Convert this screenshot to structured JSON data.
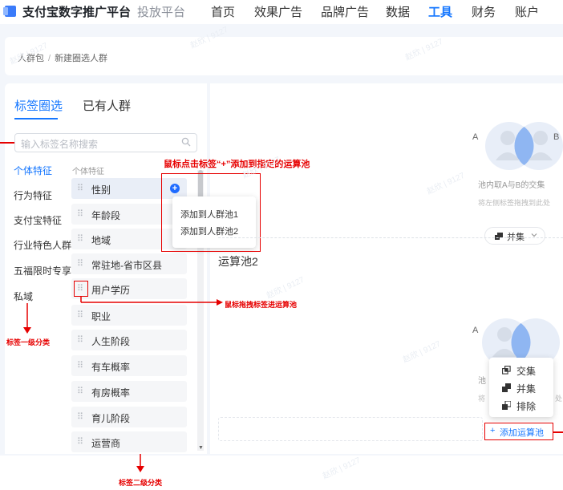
{
  "nav": {
    "brand": "支付宝数字推广平台",
    "sub": "投放平台",
    "items": [
      {
        "label": "首页",
        "active": false
      },
      {
        "label": "效果广告",
        "active": false
      },
      {
        "label": "品牌广告",
        "active": false
      },
      {
        "label": "数据",
        "active": false
      },
      {
        "label": "工具",
        "active": true
      },
      {
        "label": "财务",
        "active": false
      },
      {
        "label": "账户",
        "active": false
      }
    ]
  },
  "breadcrumb": {
    "root": "人群包",
    "separator": "/",
    "current": "新建圈选人群"
  },
  "tabs": [
    {
      "label": "标签圈选",
      "active": true
    },
    {
      "label": "已有人群",
      "active": false
    }
  ],
  "search": {
    "placeholder": "输入标签名称搜索"
  },
  "categories": [
    {
      "label": "个体特征",
      "active": true
    },
    {
      "label": "行为特征",
      "active": false
    },
    {
      "label": "支付宝特征",
      "active": false
    },
    {
      "label": "行业特色人群",
      "active": false
    },
    {
      "label": "五福限时专享",
      "active": false
    },
    {
      "label": "私域",
      "active": false
    }
  ],
  "subcategory_heading": "个体特征",
  "tags": [
    "性别",
    "年龄段",
    "地域",
    "常驻地-省市区县",
    "用户学历",
    "职业",
    "人生阶段",
    "有车概率",
    "有房概率",
    "育儿阶段",
    "运营商"
  ],
  "popup_menu": [
    "添加到人群池1",
    "添加到人群池2"
  ],
  "annotations": {
    "click_plus": "鼠标点击标签“+”添加到指定的运算池",
    "drag": "鼠标拖拽标签进运算池",
    "level1": "标签一级分类",
    "level2": "标签二级分类"
  },
  "pool1": {
    "caption": "池内取A与B的交集",
    "hint": "将左侧标签拖拽到此处",
    "a": "A",
    "b": "B"
  },
  "mode_button": {
    "label": "并集"
  },
  "pool2": {
    "title": "运算池2",
    "caption_partial": "池",
    "hint_partial": "将",
    "hint_tail": "处",
    "a": "A"
  },
  "operations": [
    "交集",
    "并集",
    "排除"
  ],
  "add_pool": {
    "label": "添加运算池"
  },
  "watermark": "赵欣 | 9127",
  "colors": {
    "accent": "#1677ff",
    "annotation": "#e60000"
  }
}
